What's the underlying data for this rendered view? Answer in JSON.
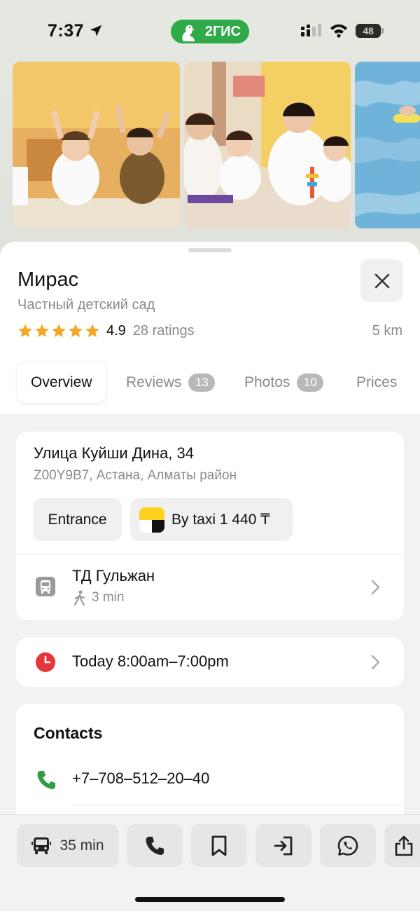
{
  "status_bar": {
    "time": "7:37",
    "brand": "2ГИС",
    "battery": "48"
  },
  "place": {
    "name": "Мирас",
    "category": "Частный детский сад",
    "rating_value": "4.9",
    "rating_count": "28 ratings",
    "distance": "5 km",
    "stars": 5
  },
  "tabs": [
    {
      "label": "Overview",
      "active": true
    },
    {
      "label": "Reviews",
      "badge": "13"
    },
    {
      "label": "Photos",
      "badge": "10"
    },
    {
      "label": "Prices"
    }
  ],
  "address": {
    "street": "Улица Куйши Дина, 34",
    "details": "Z00Y9B7, Астана, Алматы район",
    "entrance_label": "Entrance",
    "taxi_label": "By taxi 1 440 ₸"
  },
  "transit": {
    "stop_name": "ТД Гульжан",
    "walk_time": "3 min"
  },
  "hours": {
    "text": "Today 8:00am–7:00pm"
  },
  "contacts": {
    "title": "Contacts",
    "phone": "+7‒708‒512‒20‒40"
  },
  "bottom_actions": {
    "route_label": "35 min"
  },
  "colors": {
    "brand_green": "#2faa48",
    "star": "#f5a623",
    "clock_red": "#e5353b",
    "phone_green": "#2f9e44",
    "taxi_yellow": "#ffd21f"
  }
}
